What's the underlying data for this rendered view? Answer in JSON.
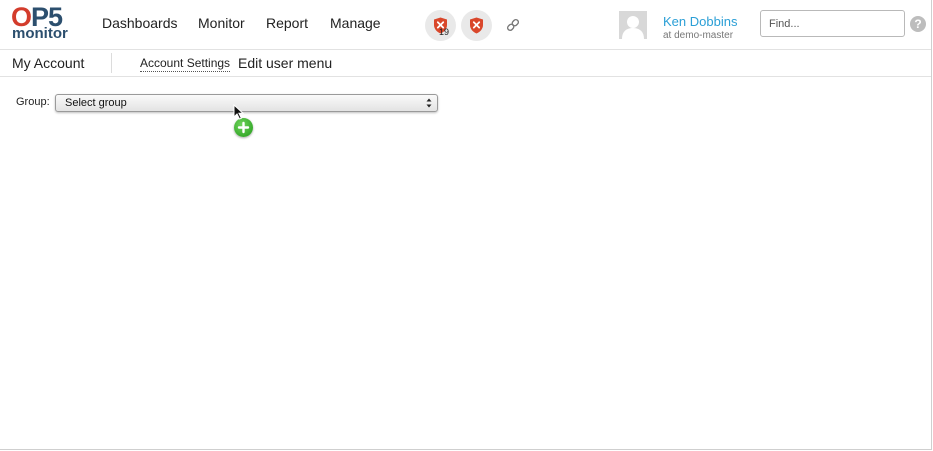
{
  "header": {
    "logo": {
      "top_text": "OP5",
      "top_accent_letter": "O",
      "top_rest": "P5",
      "bottom_text": "monitor"
    },
    "nav": [
      {
        "label": "Dashboards"
      },
      {
        "label": "Monitor"
      },
      {
        "label": "Report"
      },
      {
        "label": "Manage"
      }
    ],
    "status": {
      "host_problems_count": "19",
      "host_icon": "shield-x-icon",
      "service_icon": "shield-x-icon",
      "link_icon": "link-icon"
    },
    "user": {
      "name": "Ken Dobbins",
      "host": "at demo-master"
    },
    "search": {
      "placeholder": "Find...",
      "value": ""
    },
    "help_icon": "?"
  },
  "subbar": {
    "title": "My Account",
    "links": [
      {
        "label": "Account Settings"
      },
      {
        "label": "Edit user menu"
      }
    ]
  },
  "main": {
    "group_label": "Group:",
    "group_select_value": "Select group",
    "add_icon": "plus-circle-icon"
  },
  "colors": {
    "brand_dark": "#2c4f6e",
    "brand_red": "#d33c2c",
    "user_link": "#2b9fd6",
    "status_red": "#d9472b",
    "add_green": "#2fa823"
  }
}
